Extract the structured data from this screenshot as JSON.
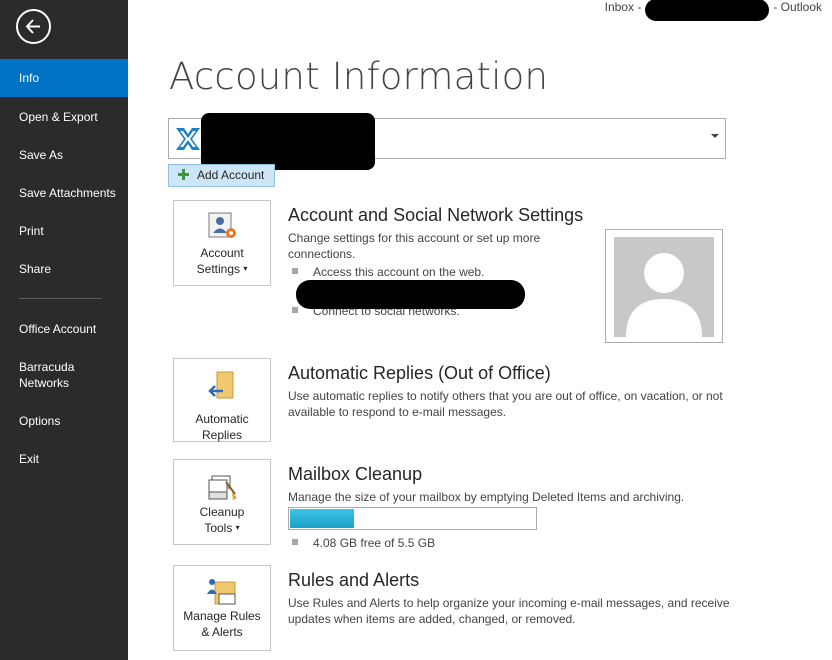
{
  "titlebar": {
    "prefix": "Inbox -",
    "suffix": "- Outlook"
  },
  "sidebar": {
    "items": [
      {
        "label": "Info",
        "active": true
      },
      {
        "label": "Open & Export"
      },
      {
        "label": "Save As"
      },
      {
        "label": "Save Attachments"
      },
      {
        "label": "Print"
      },
      {
        "label": "Share"
      },
      {
        "label": "Office Account"
      },
      {
        "label": "Barracuda Networks"
      },
      {
        "label": "Options"
      },
      {
        "label": "Exit"
      }
    ]
  },
  "main": {
    "title": "Account Information",
    "add_account_label": "Add Account",
    "account_settings": {
      "tile_label": "Account Settings",
      "title": "Account and Social Network Settings",
      "description": "Change settings for this account or set up more connections.",
      "bullets": [
        "Access this account on the web.",
        "Connect to social networks."
      ]
    },
    "automatic_replies": {
      "tile_label": "Automatic Replies",
      "title": "Automatic Replies (Out of Office)",
      "description": "Use automatic replies to notify others that you are out of office, on vacation, or not available to respond to e-mail messages."
    },
    "mailbox_cleanup": {
      "tile_label": "Cleanup Tools",
      "title": "Mailbox Cleanup",
      "description": "Manage the size of your mailbox by emptying Deleted Items and archiving.",
      "free_space": "4.08 GB free of 5.5 GB",
      "used_fraction": 0.26
    },
    "rules_alerts": {
      "tile_label": "Manage Rules & Alerts",
      "title": "Rules and Alerts",
      "description": "Use Rules and Alerts to help organize your incoming e-mail messages, and receive updates when items are added, changed, or removed."
    }
  },
  "colors": {
    "sidebar_bg": "#2b2b2b",
    "active_nav": "#0072c6",
    "progress_fill": "#29b3d7"
  },
  "icons": [
    "back-arrow-icon",
    "exchange-icon",
    "plus-icon",
    "account-settings-icon",
    "automatic-replies-icon",
    "cleanup-tools-icon",
    "manage-rules-icon",
    "person-silhouette-icon"
  ]
}
